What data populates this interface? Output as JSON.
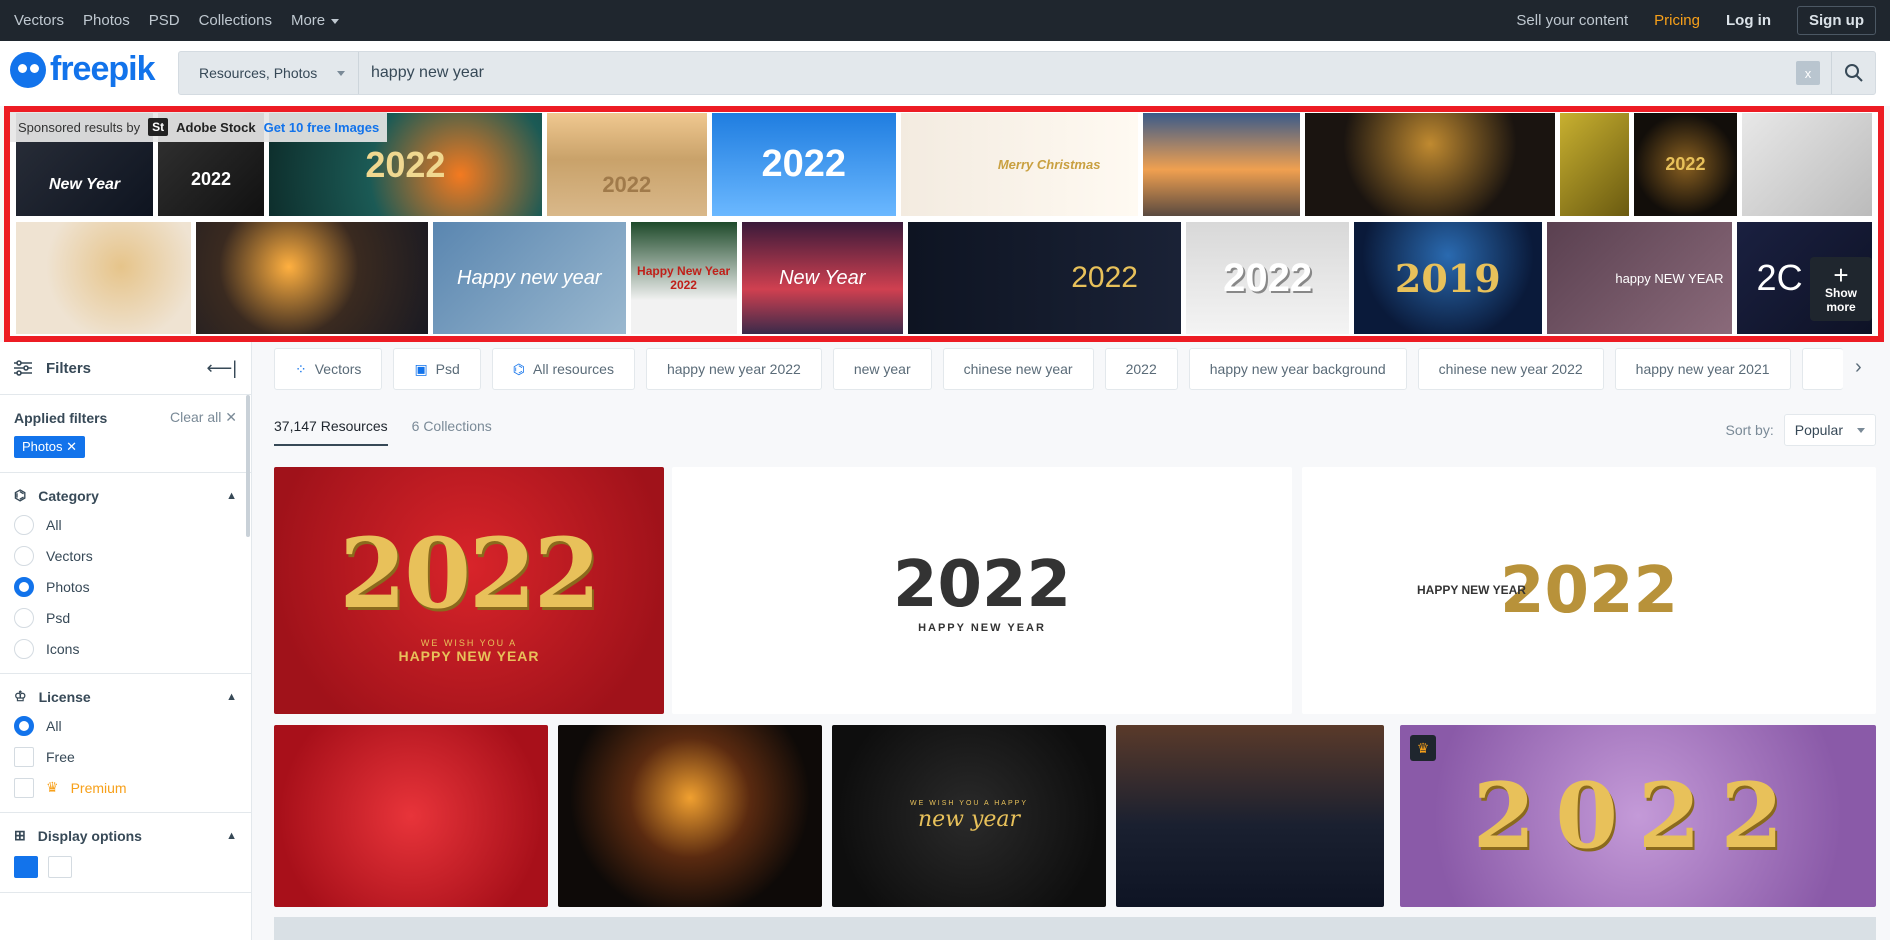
{
  "topnav": {
    "left": [
      "Vectors",
      "Photos",
      "PSD",
      "Collections",
      "More"
    ],
    "sell": "Sell your content",
    "pricing": "Pricing",
    "login": "Log in",
    "signup": "Sign up",
    "colors": {
      "bg": "#1f262e",
      "pricing": "#f7a01a"
    }
  },
  "header": {
    "logo": "freepik",
    "search_type": "Resources, Photos",
    "query": "happy new year",
    "clear_label": "x"
  },
  "sponsored": {
    "label": "Sponsored results by",
    "badge": "St",
    "brand": "Adobe Stock",
    "offer": "Get 10 free Images",
    "row1_texts": [
      "New Year",
      "2022",
      "2022",
      "2022",
      "2022",
      "Merry Christmas",
      "",
      "",
      "",
      "2022",
      ""
    ],
    "row2_texts": [
      "",
      "",
      "Happy new year",
      "Happy New Year 2022",
      "New Year",
      "2022",
      "2022",
      "2019",
      "happy NEW YEAR",
      "2C"
    ],
    "show_more": "Show more"
  },
  "sidebar": {
    "title": "Filters",
    "applied": {
      "title": "Applied filters",
      "clear_all": "Clear all",
      "chips": [
        "Photos"
      ]
    },
    "category": {
      "title": "Category",
      "options": [
        "All",
        "Vectors",
        "Photos",
        "Psd",
        "Icons"
      ],
      "selected": "Photos"
    },
    "license": {
      "title": "License",
      "options": [
        "All",
        "Free",
        "Premium"
      ],
      "selected": "All"
    },
    "display": {
      "title": "Display options",
      "selected": "grid-large"
    }
  },
  "tags": [
    {
      "label": "Vectors",
      "icon": "vectors-icon"
    },
    {
      "label": "Psd",
      "icon": "psd-icon"
    },
    {
      "label": "All resources",
      "icon": "shapes-icon"
    },
    {
      "label": "happy new year 2022"
    },
    {
      "label": "new year"
    },
    {
      "label": "chinese new year"
    },
    {
      "label": "2022"
    },
    {
      "label": "happy new year background"
    },
    {
      "label": "chinese new year 2022"
    },
    {
      "label": "happy new year 2021"
    }
  ],
  "results": {
    "tabs": [
      "37,147 Resources",
      "6 Collections"
    ],
    "sort_label": "Sort by:",
    "sort_value": "Popular"
  },
  "images": [
    {
      "title": "2022",
      "subtitle": "WE WISH YOU A",
      "caption": "HAPPY NEW YEAR"
    },
    {
      "title": "2022",
      "caption": "HAPPY NEW YEAR"
    },
    {
      "title": "2022",
      "caption": "HAPPY NEW YEAR"
    },
    {
      "title": ""
    },
    {
      "title": ""
    },
    {
      "title": "new year",
      "subtitle": "WE WISH YOU A HAPPY"
    },
    {
      "title": ""
    },
    {
      "title": "2022",
      "premium": true
    }
  ],
  "accent": "#1273eb"
}
